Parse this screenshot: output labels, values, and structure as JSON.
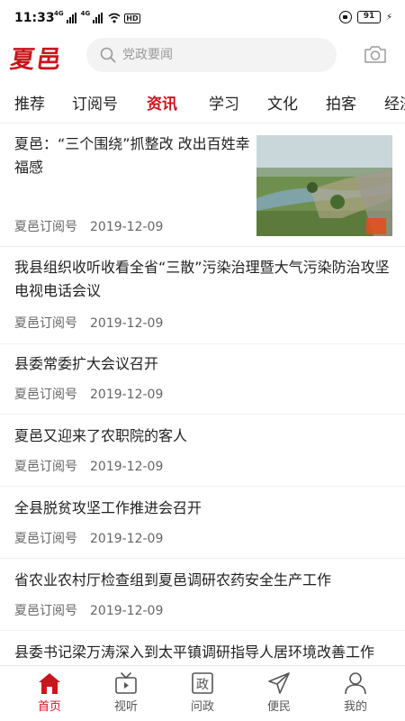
{
  "status_bar": {
    "time": "11:33",
    "signal_1_label": "4G",
    "signal_2_label": "4G",
    "hd_label": "HD",
    "battery": "91"
  },
  "header": {
    "logo_text": "夏邑",
    "search_placeholder": "党政要闻",
    "accent_color": "#c8161d"
  },
  "tabs": [
    {
      "label": "推荐",
      "active": false
    },
    {
      "label": "订阅号",
      "active": false
    },
    {
      "label": "资讯",
      "active": true
    },
    {
      "label": "学习",
      "active": false
    },
    {
      "label": "文化",
      "active": false
    },
    {
      "label": "拍客",
      "active": false
    },
    {
      "label": "经济",
      "active": false
    }
  ],
  "news": [
    {
      "title": "夏邑：“三个围绕”抓整改 改出百姓幸福感",
      "source": "夏邑订阅号",
      "date": "2019-12-09",
      "has_image": true
    },
    {
      "title": "我县组织收听收看全省“三散”污染治理暨大气污染防治攻坚电视电话会议",
      "source": "夏邑订阅号",
      "date": "2019-12-09"
    },
    {
      "title": "县委常委扩大会议召开",
      "source": "夏邑订阅号",
      "date": "2019-12-09"
    },
    {
      "title": "夏邑又迎来了农职院的客人",
      "source": "夏邑订阅号",
      "date": "2019-12-09"
    },
    {
      "title": "全县脱贫攻坚工作推进会召开",
      "source": "夏邑订阅号",
      "date": "2019-12-09"
    },
    {
      "title": "省农业农村厅检查组到夏邑调研农药安全生产工作",
      "source": "夏邑订阅号",
      "date": "2019-12-09"
    },
    {
      "title": "县委书记梁万涛深入到太平镇调研指导人居环境改善工作",
      "source": "",
      "date": ""
    }
  ],
  "bottom_nav": [
    {
      "label": "首页",
      "icon": "home-icon",
      "active": true
    },
    {
      "label": "视听",
      "icon": "tv-icon",
      "active": false
    },
    {
      "label": "问政",
      "icon": "government-icon",
      "active": false
    },
    {
      "label": "便民",
      "icon": "send-icon",
      "active": false
    },
    {
      "label": "我的",
      "icon": "user-icon",
      "active": false
    }
  ]
}
